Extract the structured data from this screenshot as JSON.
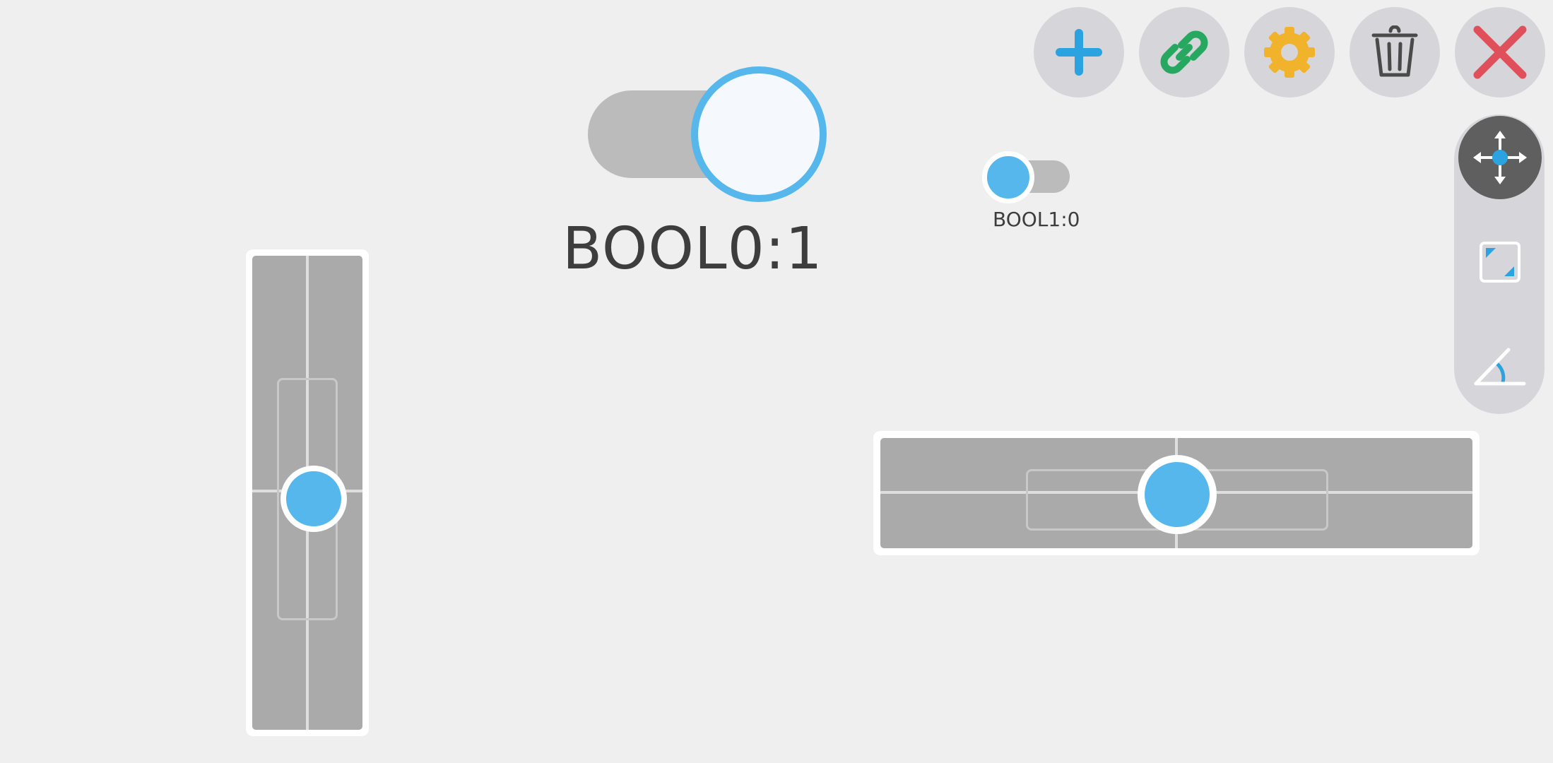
{
  "toggles": {
    "bool0": {
      "label": "BOOL0:1",
      "value": 1
    },
    "bool1": {
      "label": "BOOL1:0",
      "value": 0
    }
  },
  "toolbar": {
    "buttons": [
      {
        "icon": "plus-icon",
        "color": "#2aa3e0"
      },
      {
        "icon": "link-icon",
        "color": "#27a861"
      },
      {
        "icon": "gear-icon",
        "color": "#f1b22c"
      },
      {
        "icon": "trash-icon",
        "color": "#4a4a4a"
      },
      {
        "icon": "close-icon",
        "color": "#e0505b"
      }
    ]
  },
  "side_tools": [
    {
      "icon": "move-icon",
      "active": true
    },
    {
      "icon": "resize-icon",
      "active": false
    },
    {
      "icon": "rotate-icon",
      "active": false
    }
  ],
  "sliders": {
    "vertical": {
      "value": 0.5
    },
    "horizontal": {
      "value": 0.5
    }
  },
  "colors": {
    "accent": "#55b7ec",
    "background": "#efefef",
    "track": "#aaaaaa",
    "button_bg": "#d6d5da"
  }
}
